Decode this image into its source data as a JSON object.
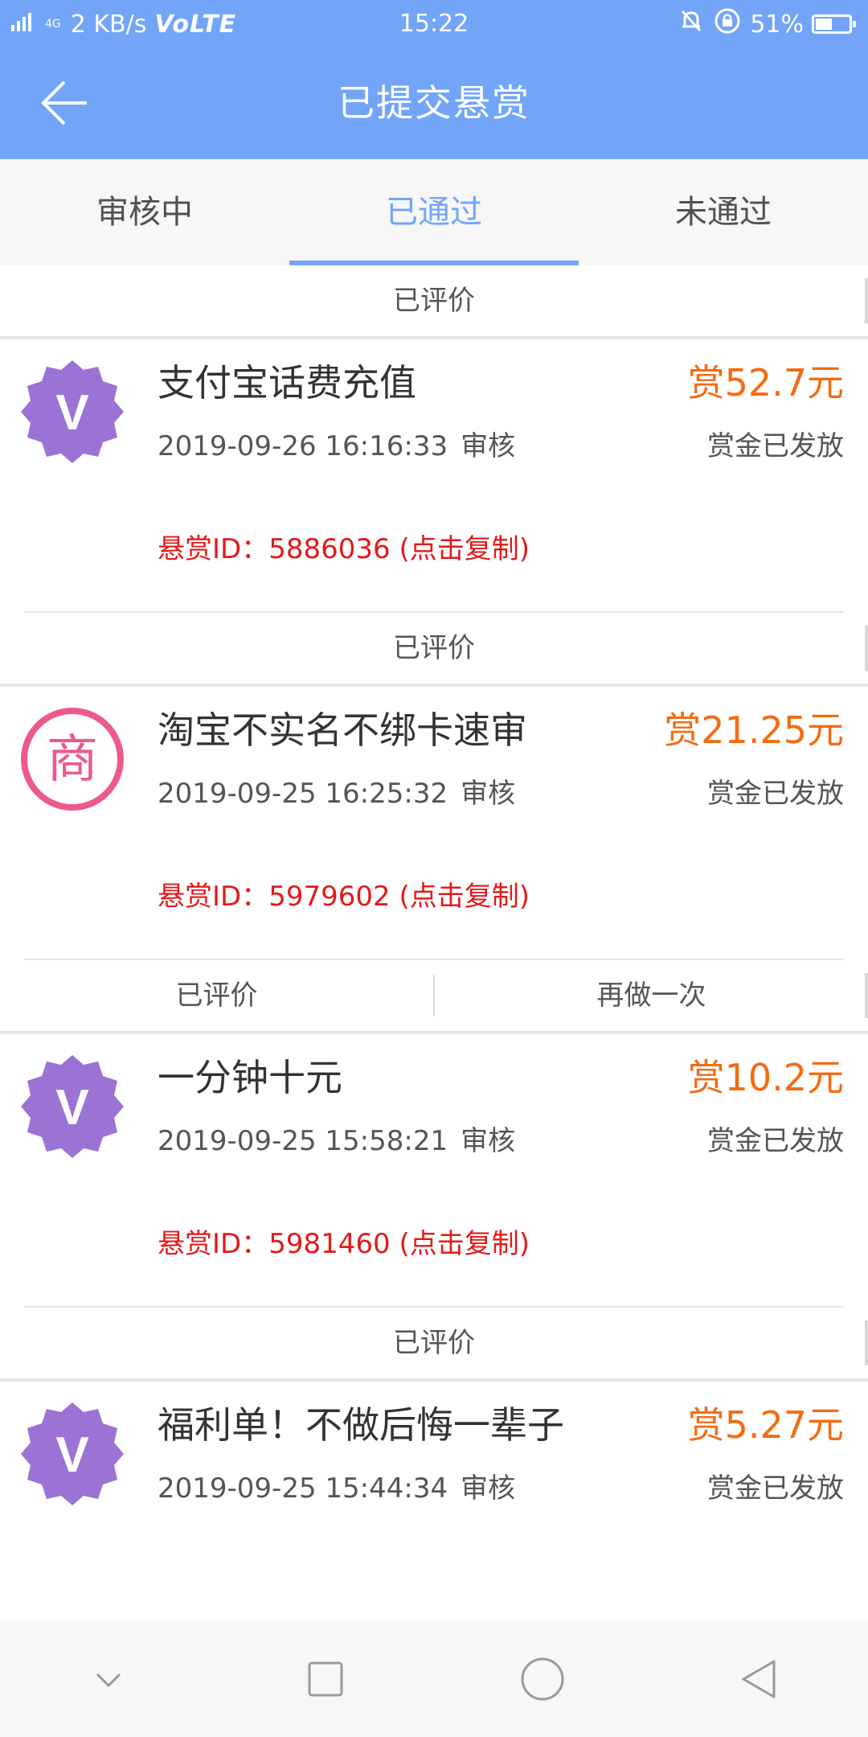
{
  "status_bar": {
    "network": "4G",
    "speed": "2 KB/s",
    "volte": "VoLTE",
    "time": "15:22",
    "battery": "51%",
    "battery_level": 0.51
  },
  "header": {
    "title": "已提交悬赏"
  },
  "tabs": [
    {
      "label": "审核中"
    },
    {
      "label": "已通过"
    },
    {
      "label": "未通过"
    }
  ],
  "list": {
    "top_action": {
      "rated": "已评价"
    },
    "items": [
      {
        "logo": "V",
        "logo_color": "#9a73d4",
        "title": "支付宝话费充值",
        "reward": "赏52.7元",
        "datetime": "2019-09-26 16:16:33",
        "status": "审核",
        "paid": "赏金已发放",
        "reward_id": "悬赏ID：5886036 (点击复制)",
        "actions": [
          "已评价"
        ]
      },
      {
        "logo": "商",
        "logo_color": "#ec5a8a",
        "title": "淘宝不实名不绑卡速审",
        "reward": "赏21.25元",
        "datetime": "2019-09-25 16:25:32",
        "status": "审核",
        "paid": "赏金已发放",
        "reward_id": "悬赏ID：5979602 (点击复制)",
        "actions": [
          "已评价",
          "再做一次"
        ]
      },
      {
        "logo": "V",
        "logo_color": "#9a73d4",
        "title": "一分钟十元",
        "reward": "赏10.2元",
        "datetime": "2019-09-25 15:58:21",
        "status": "审核",
        "paid": "赏金已发放",
        "reward_id": "悬赏ID：5981460 (点击复制)",
        "actions": [
          "已评价"
        ]
      },
      {
        "logo": "V",
        "logo_color": "#9a73d4",
        "title": "福利单！不做后悔一辈子",
        "reward": "赏5.27元",
        "datetime": "2019-09-25 15:44:34",
        "status": "审核",
        "paid": "赏金已发放"
      }
    ]
  },
  "icons": {
    "back": "back-arrow-icon",
    "nav": [
      "chevron-down-icon",
      "square-icon",
      "circle-icon",
      "triangle-back-icon"
    ]
  },
  "colors": {
    "primary": "#72a5f8",
    "reward": "#f36c12",
    "reward_id": "#e21a1a"
  }
}
